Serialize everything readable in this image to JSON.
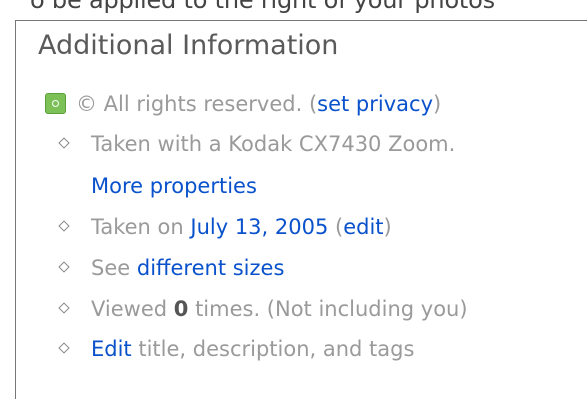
{
  "top_clipped_text": "o be applied to the right of your photos",
  "panel": {
    "heading": "Additional Information",
    "license": {
      "icon": "license-badge-icon",
      "text": "© All rights reserved. (",
      "link": "set privacy",
      "text_after": ")"
    },
    "camera": {
      "prefix": "Taken with a Kodak CX7430 Zoom.",
      "link": "More properties"
    },
    "taken_on": {
      "prefix": "Taken on ",
      "date_link": "July 13, 2005",
      "paren_open": " (",
      "edit_link": "edit",
      "paren_close": ")"
    },
    "sizes": {
      "prefix": "See ",
      "link": "different sizes"
    },
    "views": {
      "prefix": "Viewed ",
      "count": "0",
      "suffix": " times.  (Not including you)"
    },
    "edit": {
      "link": "Edit",
      "suffix": " title, description, and tags"
    },
    "colors": {
      "link": "#0a52cc",
      "text": "#9a9a9a",
      "heading": "#5a5a5a",
      "badge": "#7cc157"
    }
  }
}
